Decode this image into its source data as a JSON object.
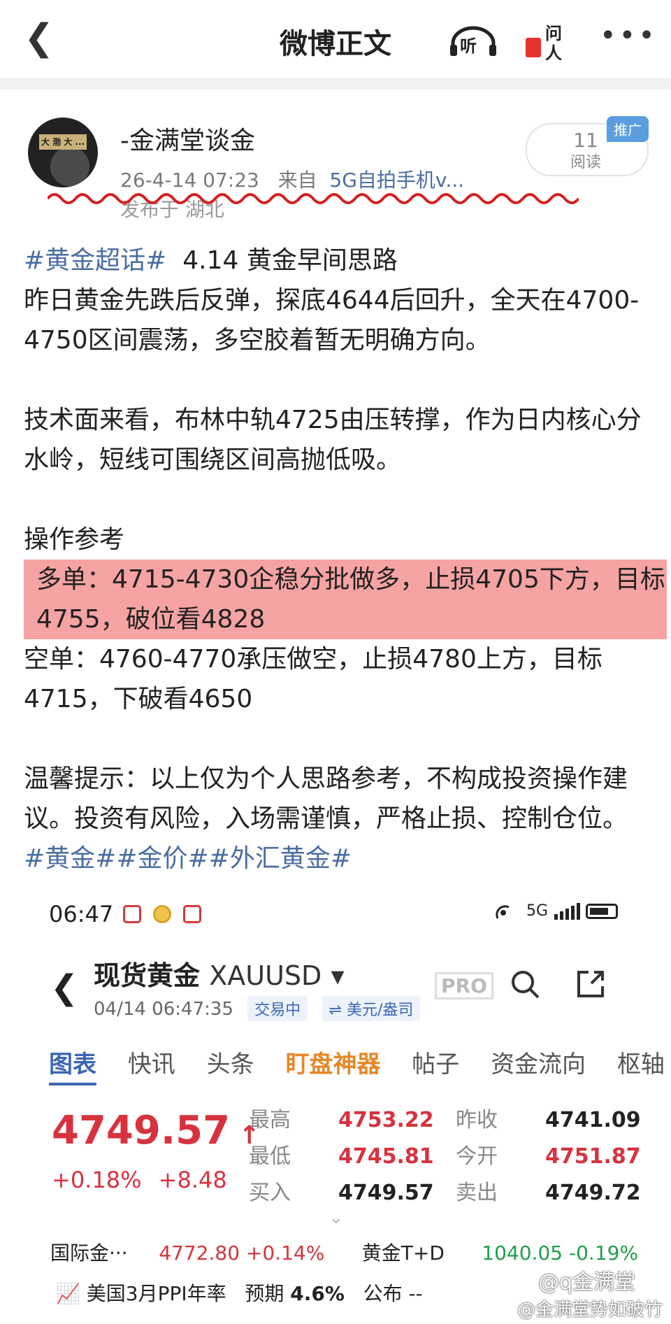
{
  "header": {
    "title": "微博正文",
    "listen_label": "听",
    "ask_label_top": "问",
    "ask_label_bottom": "人"
  },
  "post": {
    "author": "-金满堂谈金",
    "date": "26-4-14 07:23",
    "source_prefix": "来自",
    "source": "5G自拍手机v...",
    "location": "发布于 湖北",
    "read_count": "11",
    "read_label": "阅读",
    "promo_badge": "推广",
    "paragraphs": {
      "p1_tag": "#黄金超话#",
      "p1_title": "4.14 黄金早间思路",
      "p1_text": "昨日黄金先跌后反弹，探底4644后回升，全天在4700-4750区间震荡，多空胶着暂无明确方向。",
      "p2": "技术面来看，布林中轨4725由压转撑，作为日内核心分水岭，短线可围绕区间高抛低吸。",
      "p3_title": "操作参考",
      "p3_long": "多单：4715-4730企稳分批做多，止损4705下方，目标4755，破位看4828",
      "p3_short": "空单：4760-4770承压做空，止损4780上方，目标4715，下破看4650",
      "p4": "温馨提示：以上仅为个人思路参考，不构成投资操作建议。投资有风险，入场需谨慎，严格止损、控制仓位。",
      "tags": "#黄金##金价##外汇黄金#"
    }
  },
  "screenshot": {
    "status_time": "06:47",
    "network": "5G",
    "instrument_name": "现货黄金",
    "instrument_code": "XAUUSD",
    "instrument_date": "04/14 06:47:35",
    "chip_trading": "交易中",
    "chip_unit": "⇌ 美元/盎司",
    "pro_label": "PRO",
    "tabs": [
      "图表",
      "快讯",
      "头条",
      "盯盘神器",
      "帖子",
      "资金流向",
      "枢轴"
    ],
    "price": "4749.57",
    "change_pct": "+0.18%",
    "change_abs": "+8.48",
    "quotes": {
      "high_label": "最高",
      "high": "4753.22",
      "prev_close_label": "昨收",
      "prev_close": "4741.09",
      "low_label": "最低",
      "low": "4745.81",
      "open_label": "今开",
      "open": "4751.87",
      "bid_label": "买入",
      "bid": "4749.57",
      "ask_label": "卖出",
      "ask": "4749.72"
    },
    "intl_gold_label": "国际金···",
    "intl_gold_value": "4772.80",
    "intl_gold_change": "+0.14%",
    "td_label": "黄金T+D",
    "td_value": "1040.05",
    "td_change": "-0.19%",
    "ppi_label": "美国3月PPI年率",
    "expected_label": "预期",
    "expected_value": "4.6%",
    "publish_label": "公布",
    "publish_value": "--"
  },
  "watermark": {
    "line1": "@q金满堂",
    "line2": "@金满堂势如破竹"
  },
  "colors": {
    "accent": "#4a6da0",
    "up": "#d6333f",
    "down": "#1f9e4c",
    "highlight": "#f6a3a3"
  }
}
